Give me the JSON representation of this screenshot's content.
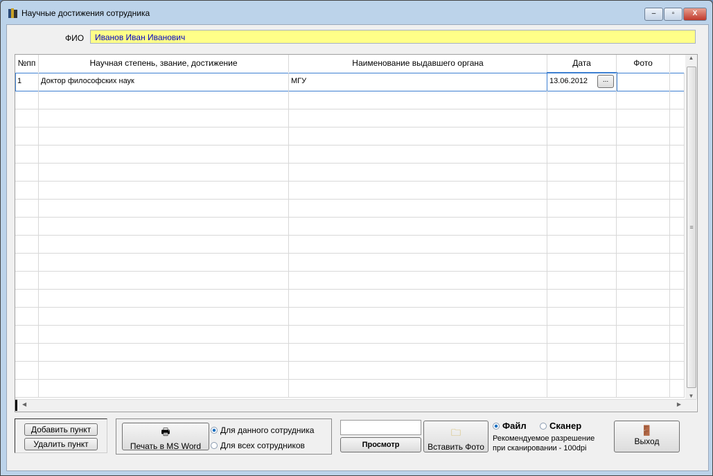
{
  "window": {
    "title": "Научные достижения сотрудника",
    "minimize": "‒",
    "maximize": "▫",
    "close": "X"
  },
  "fio": {
    "label": "ФИО",
    "value": "Иванов Иван Иванович"
  },
  "table": {
    "columns": [
      "№пп",
      "Научная степень, звание, достижение",
      "Наименование выдавшего органа",
      "Дата",
      "Фото"
    ],
    "rows": [
      {
        "num": "1",
        "degree": "Доктор философских наук",
        "issuer": "МГУ",
        "date": "13.06.2012",
        "photo": ""
      }
    ],
    "date_picker": "..."
  },
  "buttons": {
    "add": "Добавить пункт",
    "delete": "Удалить пункт",
    "print": "Печать в MS Word",
    "view": "Просмотр",
    "insert_photo": "Вставить Фото",
    "exit": "Выход"
  },
  "print_scope": {
    "options": [
      "Для данного сотрудника",
      "Для всех сотрудников"
    ],
    "selected": 0
  },
  "source": {
    "options": [
      "Файл",
      "Сканер"
    ],
    "selected": 0,
    "hint1": "Рекомендуемое разрешение",
    "hint2": "при сканировании - 100dpi"
  },
  "view_field": {
    "value": ""
  }
}
